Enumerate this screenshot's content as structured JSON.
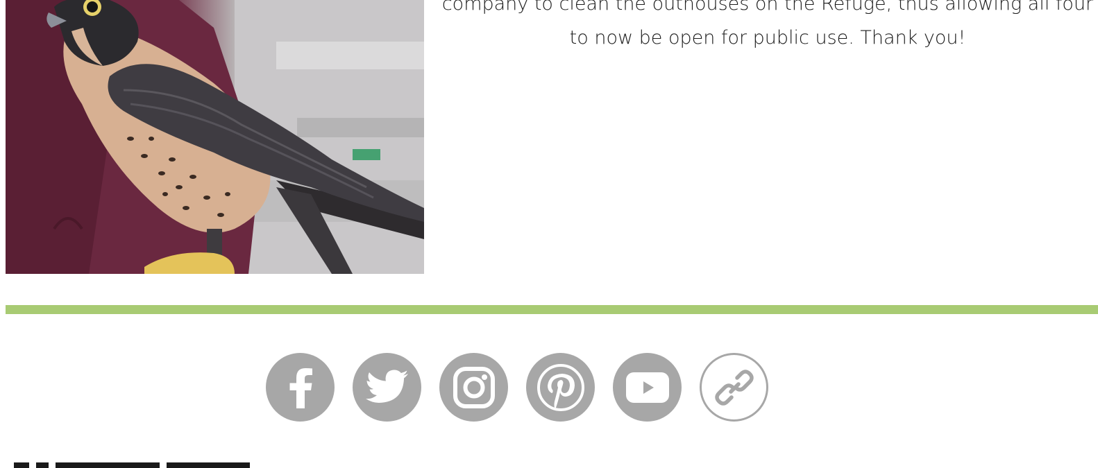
{
  "article": {
    "line1": "company to clean the outhouses on the Refuge, thus allowing all four",
    "line2": "to now be open for public use. Thank you!"
  },
  "image": {
    "subject": "peregrine falcon perched on a gloved hand"
  },
  "colors": {
    "divider": "#a8cb73",
    "social_icon_bg": "#a7a7a7"
  },
  "social": [
    {
      "icon": "facebook-icon"
    },
    {
      "icon": "twitter-icon"
    },
    {
      "icon": "instagram-icon"
    },
    {
      "icon": "pinterest-icon"
    },
    {
      "icon": "youtube-icon"
    },
    {
      "icon": "link-icon"
    }
  ]
}
